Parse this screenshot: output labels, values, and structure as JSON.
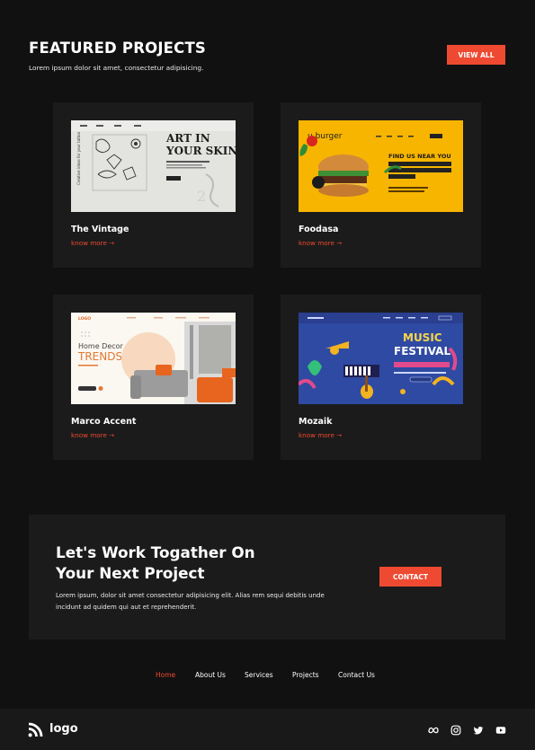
{
  "header": {
    "title": "FEATURED PROJECTS",
    "subtitle": "Lorem ipsum dolor sit amet, consectetur adipisicing.",
    "view_all_label": "VIEW ALL"
  },
  "projects": [
    {
      "title": "The Vintage",
      "link": "know more →",
      "thumb": {
        "headline_1": "ART IN",
        "headline_2": "YOUR SKIN"
      }
    },
    {
      "title": "Foodasa",
      "link": "know more →",
      "thumb": {
        "brand": "u.burger",
        "headline": "FIND US NEAR YOU"
      }
    },
    {
      "title": "Marco Accent",
      "link": "know more →",
      "thumb": {
        "logo": "LOGO",
        "headline": "Home Decor",
        "headline_2": "TRENDS"
      }
    },
    {
      "title": "Mozaik",
      "link": "know more →",
      "thumb": {
        "headline": "MUSIC",
        "headline_2": "FESTIVAL"
      }
    }
  ],
  "cta": {
    "title_line_1": "Let's Work Togather On",
    "title_line_2": "Your Next Project",
    "description": "Lorem ipsum, dolor sit amet consectetur adipisicing elit. Alias rem sequi debitis unde incidunt ad quidem qui aut et reprehenderit.",
    "button_label": "CONTACT"
  },
  "nav": {
    "items": [
      "Home",
      "About Us",
      "Services",
      "Projects",
      "Contact Us"
    ],
    "active": "Home"
  },
  "footer": {
    "logo_text": "logo",
    "social_icons": [
      "meta-icon",
      "instagram-icon",
      "twitter-icon",
      "youtube-icon"
    ]
  },
  "colors": {
    "background": "#111111",
    "card": "#1b1b1b",
    "accent": "#ee4a31"
  }
}
